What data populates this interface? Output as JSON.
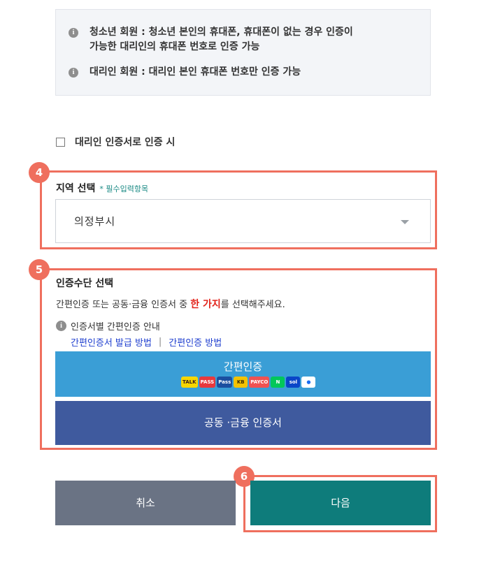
{
  "notice": {
    "items": [
      {
        "line1": "청소년 회원 : 청소년 본인의 휴대폰, 휴대폰이 없는 경우 인증이",
        "line2": "가능한 대리인의 휴대폰 번호로 인증 가능"
      },
      {
        "line1": "대리인 회원 : 대리인 본인 휴대폰 번호만 인증 가능",
        "line2": ""
      }
    ]
  },
  "proxy_checkbox": {
    "label": "대리인 인증서로 인증 시",
    "checked": false
  },
  "steps": {
    "region": "4",
    "method": "5",
    "next": "6"
  },
  "region": {
    "title": "지역 선택",
    "required_star": "*",
    "required_label": "필수입력항목",
    "selected": "의정부시"
  },
  "method": {
    "title": "인증수단 선택",
    "desc_prefix": "간편인증 또는 공동·금융 인증서 중 ",
    "desc_emphasis": "한 가지",
    "desc_suffix": "를 선택해주세요.",
    "guide_label": "인증서별 간편인증 안내",
    "link_issue": "간편인증서 발급 방법",
    "link_sep": "|",
    "link_method": "간편인증 방법",
    "simple_button": "간편인증",
    "cert_button": "공동 ·금융 인증서",
    "provider_logos": [
      {
        "icon": "kakao-icon",
        "text": "TALK",
        "color": "#f7d600",
        "text_color": "#3a1d1d"
      },
      {
        "icon": "pass-icon",
        "text": "PASS",
        "color": "#e8383d",
        "text_color": "#ffffff"
      },
      {
        "icon": "samsung-pass-icon",
        "text": "Pass",
        "color": "#1b4fa0",
        "text_color": "#ffffff"
      },
      {
        "icon": "kb-icon",
        "text": "KB",
        "color": "#f4c200",
        "text_color": "#3d2b00"
      },
      {
        "icon": "payco-icon",
        "text": "PAYCO",
        "color": "#f05252",
        "text_color": "#ffffff"
      },
      {
        "icon": "naver-icon",
        "text": "N",
        "color": "#03c75a",
        "text_color": "#ffffff"
      },
      {
        "icon": "shinhan-icon",
        "text": "sol",
        "color": "#0a46c8",
        "text_color": "#ffffff"
      },
      {
        "icon": "toss-icon",
        "text": "●",
        "color": "#ffffff",
        "text_color": "#1a6ef2"
      }
    ]
  },
  "buttons": {
    "cancel": "취소",
    "next": "다음"
  },
  "colors": {
    "highlight": "#ef6f5e",
    "simple": "#3a9ed6",
    "cert": "#3f5a9e",
    "next": "#0e7c7b",
    "cancel": "#6a7384"
  }
}
